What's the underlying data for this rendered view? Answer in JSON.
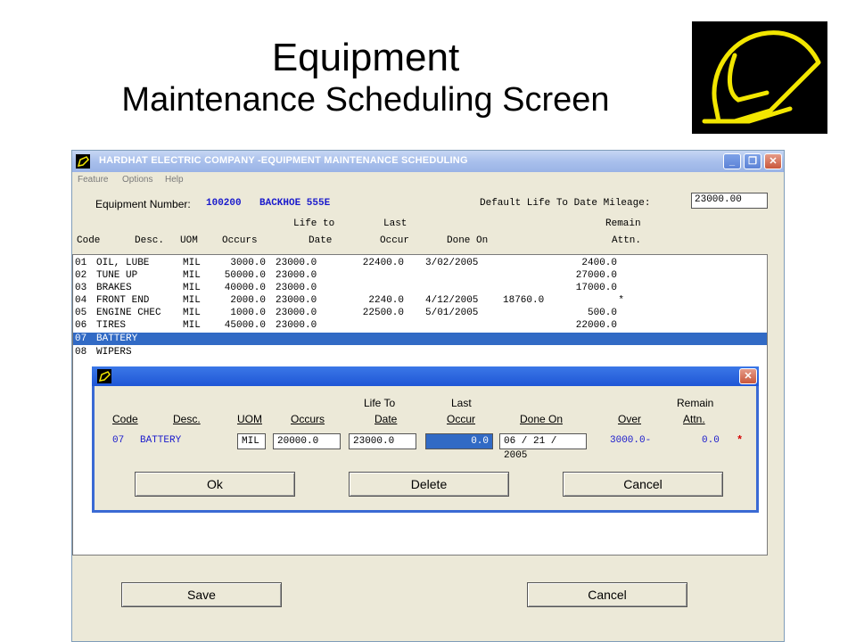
{
  "slide": {
    "title_line1": "Equipment",
    "title_line2": "Maintenance Scheduling Screen",
    "logo_color": "#f2e600"
  },
  "window": {
    "title": "HARDHAT ELECTRIC COMPANY    -EQUIPMENT MAINTENANCE SCHEDULING",
    "menu": [
      "Feature",
      "Options",
      "Help"
    ],
    "controls": [
      "minimize-icon",
      "restore-icon",
      "close-icon"
    ]
  },
  "header": {
    "equipment_label": "Equipment Number:",
    "equipment_number": "100200",
    "equipment_desc": "BACKHOE 555E",
    "mileage_label": "Default Life To Date Mileage:",
    "mileage_value": "23000.00"
  },
  "columns": {
    "row1": {
      "life_to": "Life to",
      "last": "Last",
      "remain": "Remain"
    },
    "row2": {
      "code": "Code",
      "desc": "Desc.",
      "uom": "UOM",
      "occurs": "Occurs",
      "date": "Date",
      "occur": "Occur",
      "done_on": "Done On",
      "attn": "Attn."
    }
  },
  "rows": [
    {
      "code": "01",
      "desc": "OIL, LUBE",
      "uom": "MIL",
      "occurs": "3000.0",
      "life": "23000.0",
      "last": "22400.0",
      "done": "3/02/2005",
      "over": "",
      "remain": "2400.0"
    },
    {
      "code": "02",
      "desc": "TUNE UP",
      "uom": "MIL",
      "occurs": "50000.0",
      "life": "23000.0",
      "last": "",
      "done": "",
      "over": "",
      "remain": "27000.0"
    },
    {
      "code": "03",
      "desc": "BRAKES",
      "uom": "MIL",
      "occurs": "40000.0",
      "life": "23000.0",
      "last": "",
      "done": "",
      "over": "",
      "remain": "17000.0"
    },
    {
      "code": "04",
      "desc": "FRONT END",
      "uom": "MIL",
      "occurs": "2000.0",
      "life": "23000.0",
      "last": "2240.0",
      "done": "4/12/2005",
      "over": "18760.0",
      "remain": "*"
    },
    {
      "code": "05",
      "desc": "ENGINE CHEC",
      "uom": "MIL",
      "occurs": "1000.0",
      "life": "23000.0",
      "last": "22500.0",
      "done": "5/01/2005",
      "over": "",
      "remain": "500.0"
    },
    {
      "code": "06",
      "desc": "TIRES",
      "uom": "MIL",
      "occurs": "45000.0",
      "life": "23000.0",
      "last": "",
      "done": "",
      "over": "",
      "remain": "22000.0"
    },
    {
      "code": "07",
      "desc": "BATTERY",
      "uom": "",
      "occurs": "",
      "life": "",
      "last": "",
      "done": "",
      "over": "",
      "remain": ""
    },
    {
      "code": "08",
      "desc": "WIPERS",
      "uom": "",
      "occurs": "",
      "life": "",
      "last": "",
      "done": "",
      "over": "",
      "remain": ""
    }
  ],
  "dialog": {
    "headers_top": {
      "life_to": "Life To",
      "last": "Last",
      "remain": "Remain"
    },
    "headers": {
      "code": "Code",
      "desc": "Desc.",
      "uom": "UOM",
      "occurs": "Occurs",
      "date": "Date",
      "occur": "Occur",
      "done_on": "Done On",
      "over": "Over",
      "attn": "Attn."
    },
    "code": "07",
    "desc": "BATTERY",
    "uom": "MIL",
    "occurs": "20000.0",
    "life_date": "23000.0",
    "last_occur": "0.0",
    "done_on": "06 / 21 / 2005",
    "over": "3000.0-",
    "remain_attn": "0.0",
    "flag": "*",
    "buttons": {
      "ok": "Ok",
      "delete": "Delete",
      "cancel": "Cancel"
    }
  },
  "footer": {
    "save": "Save",
    "cancel": "Cancel"
  }
}
